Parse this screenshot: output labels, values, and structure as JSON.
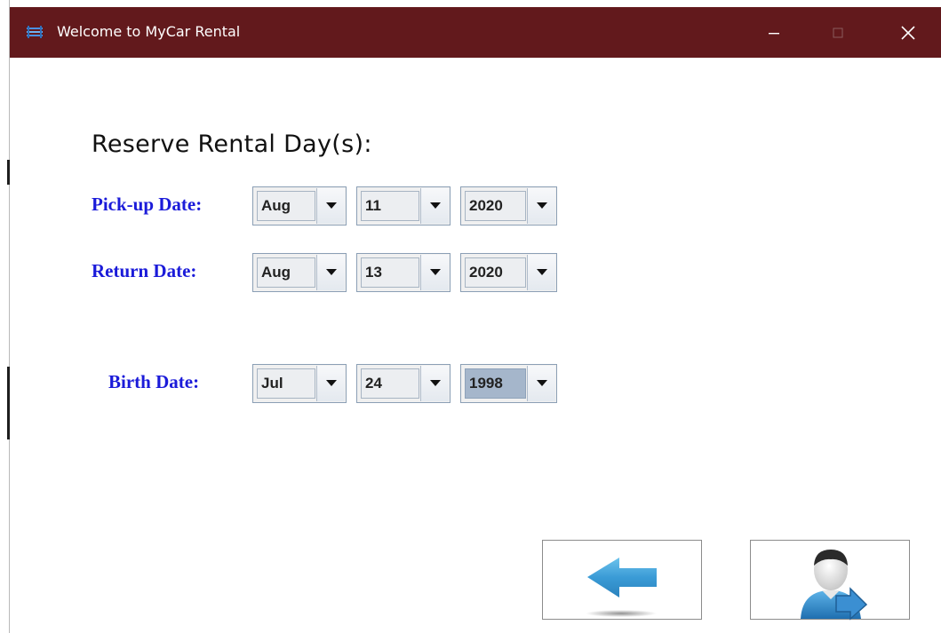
{
  "window": {
    "title": "Welcome to MyCar Rental",
    "titlebar_color": "#62191c",
    "controls": {
      "minimize": "minimize-icon",
      "maximize": "maximize-icon",
      "close": "close-icon"
    }
  },
  "heading": "Reserve Rental Day(s):",
  "label_color": "#1b1bd9",
  "pickup": {
    "label": "Pick-up Date:",
    "month": "Aug",
    "day": "11",
    "year": "2020"
  },
  "return": {
    "label": "Return Date:",
    "month": "Aug",
    "day": "13",
    "year": "2020"
  },
  "birth": {
    "label": "Birth Date:",
    "month": "Jul",
    "day": "24",
    "year": "1998"
  },
  "buttons": {
    "back": {
      "icon": "left-arrow-icon"
    },
    "next": {
      "icon": "user-arrow-icon"
    }
  }
}
